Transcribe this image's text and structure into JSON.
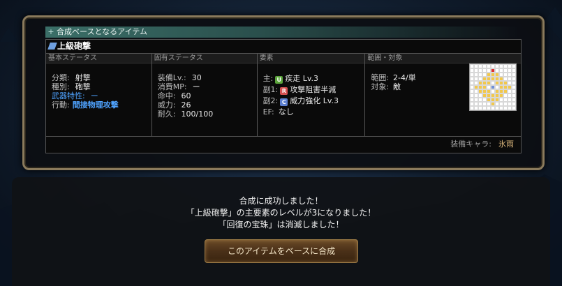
{
  "section": {
    "title": "合成ベースとなるアイテム"
  },
  "item": {
    "name": "上級砲撃",
    "columns": {
      "basic": {
        "header": "基本ステータス"
      },
      "unique": {
        "header": "固有ステータス"
      },
      "element": {
        "header": "要素"
      },
      "range": {
        "header": "範囲・対象"
      }
    },
    "basic": [
      {
        "label": "分類:",
        "value": "射撃"
      },
      {
        "label": "種別:",
        "value": "砲撃"
      },
      {
        "label": "武器特性:",
        "value": "ー"
      },
      {
        "label": "行動:",
        "value": "間接物理攻撃"
      }
    ],
    "unique": [
      {
        "label": "装備Lv.:",
        "value": "30"
      },
      {
        "label": "消費MP:",
        "value": "ー"
      },
      {
        "label": "命中:",
        "value": "60"
      },
      {
        "label": "威力:",
        "value": "26"
      },
      {
        "label": "耐久:",
        "value": "100/100"
      }
    ],
    "element": [
      {
        "label": "主:",
        "badge": "U",
        "badge_color": "#5aa33a",
        "value": "疾走 Lv.3"
      },
      {
        "label": "副1:",
        "badge": "R",
        "badge_color": "#d45050",
        "value": "攻撃阻害半減"
      },
      {
        "label": "副2:",
        "badge": "C",
        "badge_color": "#5c7fd0",
        "value": "威力強化 Lv.3"
      },
      {
        "label": "EF:",
        "value": "なし"
      }
    ],
    "range": [
      {
        "label": "範囲:",
        "value": "2-4/単"
      },
      {
        "label": "対象:",
        "value": "敵"
      }
    ],
    "equip": {
      "label": "装備キャラ:",
      "character": "氷雨"
    }
  },
  "message": {
    "lines": [
      "合成に成功しました！",
      "「上級砲撃」の主要素のレベルが3になりました！",
      "「回復の宝珠」は消滅しました！"
    ],
    "button_label": "このアイテムをベースに合成"
  }
}
